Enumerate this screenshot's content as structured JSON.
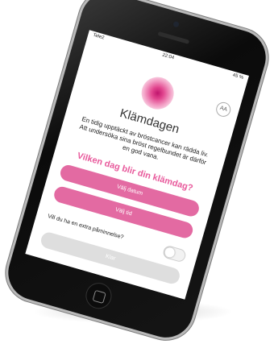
{
  "status_bar": {
    "carrier": "Tele2",
    "time": "22:04",
    "battery": "45 %"
  },
  "header": {
    "text_size_label": "AA"
  },
  "app": {
    "title": "Klämdagen",
    "intro": "En tidig upptäckt av bröstcancer kan rädda liv. Att undersöka sina bröst regelbundet är därför en god vana.",
    "question": "Vilken dag blir din klämdag?",
    "choose_date_label": "Välj datum",
    "choose_time_label": "Välj tid",
    "reminder_label": "Vill du ha en extra påminnelse?",
    "done_label": "Klar"
  },
  "colors": {
    "accent": "#e36aa2",
    "question": "#e85a9c",
    "disabled": "#dedede"
  },
  "reminder_toggle": {
    "on": false
  }
}
